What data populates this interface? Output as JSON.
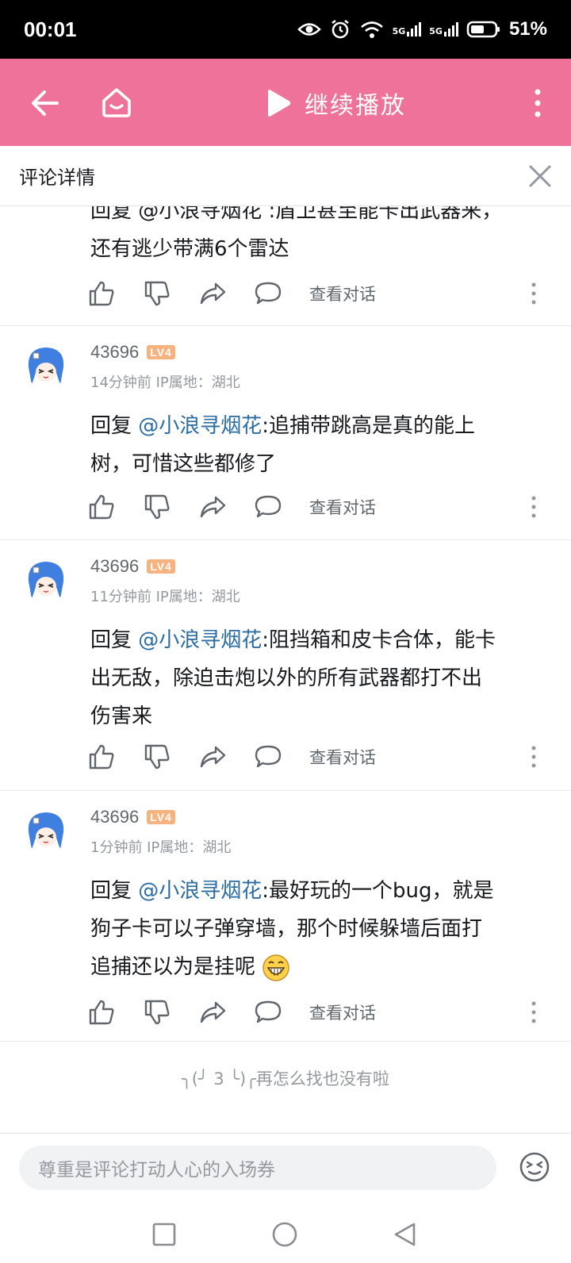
{
  "status_bar": {
    "time": "00:01",
    "network_1": "5G",
    "network_2": "5G",
    "battery": "51%"
  },
  "top_bar": {
    "continue_label": "继续播放"
  },
  "panel": {
    "title": "评论详情"
  },
  "first_partial": {
    "line1": "回复 @小浪寻烟花 :盾卫甚至能卡出武器来，",
    "line2": "还有逃少带满6个雷达",
    "view_dialog": "查看对话"
  },
  "replies": [
    {
      "username": "43696",
      "level": "LV4",
      "meta": "14分钟前 IP属地：湖北",
      "reply_prefix": "回复 ",
      "mention": "@小浪寻烟花",
      "text_lines": [
        ":追捕带跳高是真的能上",
        "树，可惜这些都修了"
      ],
      "view_dialog": "查看对话"
    },
    {
      "username": "43696",
      "level": "LV4",
      "meta": "11分钟前 IP属地：湖北",
      "reply_prefix": "回复 ",
      "mention": "@小浪寻烟花",
      "text_lines": [
        ":阻挡箱和皮卡合体，能卡",
        "出无敌，除迫击炮以外的所有武器都打不出",
        "伤害来"
      ],
      "view_dialog": "查看对话"
    },
    {
      "username": "43696",
      "level": "LV4",
      "meta": "1分钟前 IP属地：湖北",
      "reply_prefix": "回复 ",
      "mention": "@小浪寻烟花",
      "text_lines": [
        ":最好玩的一个bug，就是",
        "狗子卡可以子弹穿墙，那个时候躲墙后面打",
        "追捕还以为是挂呢"
      ],
      "view_dialog": "查看对话"
    }
  ],
  "end_tip": "╮(╯ 3 ╰)╭再怎么找也没有啦",
  "bottom": {
    "input_placeholder": "尊重是评论打动人心的入场券"
  },
  "colors": {
    "brand_pink": "#ee7299",
    "mention_blue": "#2b6ca3",
    "level_badge": "#f6b37f"
  }
}
